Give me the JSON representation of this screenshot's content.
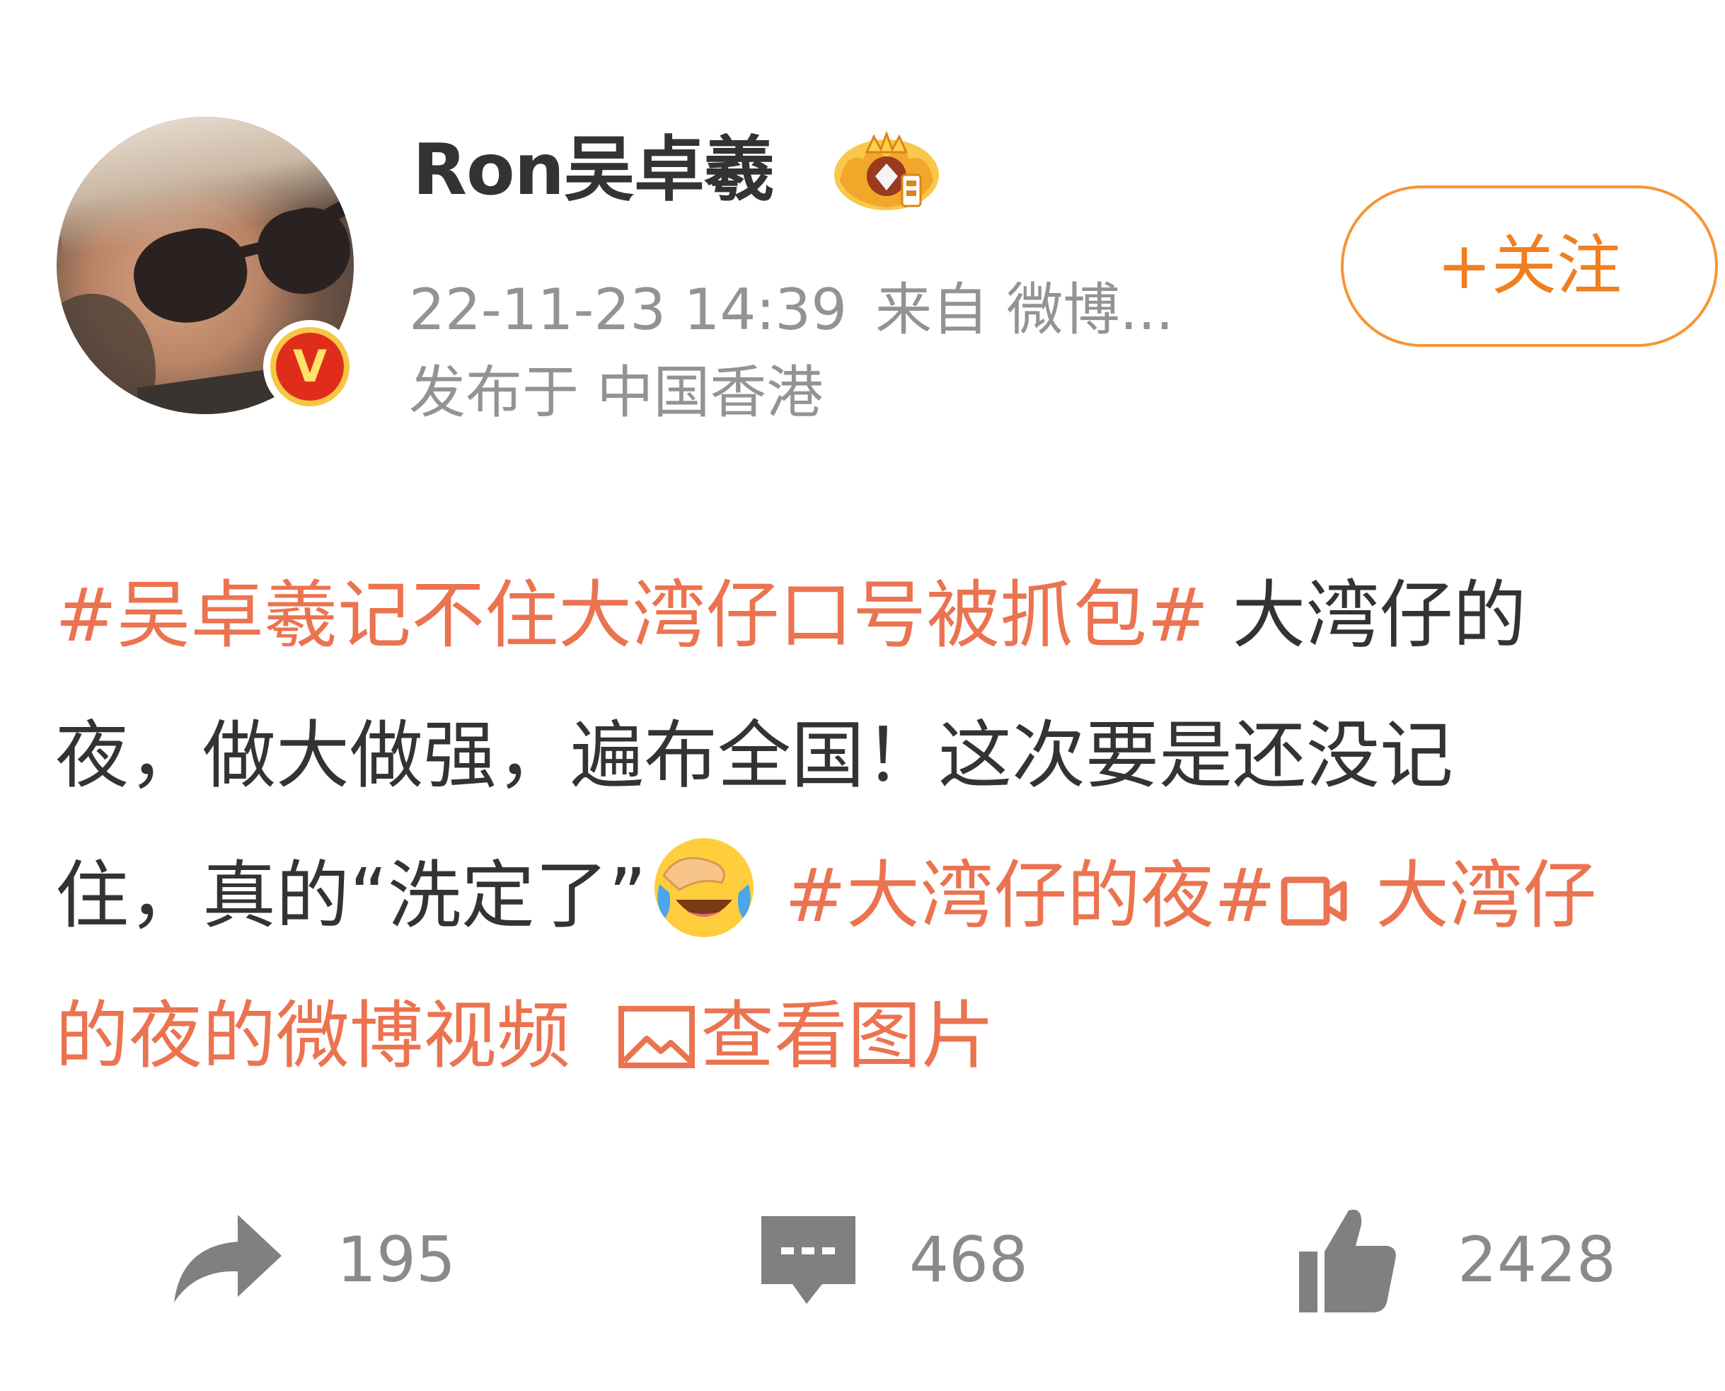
{
  "user": {
    "name": "Ron吴卓羲",
    "avatar_icon": "avatar-photo",
    "verified_badge": "V",
    "vip_icon": "crown-icon"
  },
  "meta": {
    "timestamp": "22-11-23 14:39",
    "source": "来自 微博...",
    "location": "发布于 中国香港"
  },
  "follow_button": {
    "label": "+关注"
  },
  "post": {
    "line1": {
      "tag": "#吴卓羲记不住大湾仔口号被抓包#",
      "text": " 大湾仔的"
    },
    "line2": {
      "text": "夜，做大做强，遍布全国！这次要是还没记"
    },
    "line3": {
      "text": "住，真的“洗定了”",
      "tag": " #大湾仔的夜#",
      "video_link": " 大湾仔"
    },
    "line4": {
      "video_link": "的夜的微博视频",
      "picture_link": "查看图片"
    },
    "emoji_icon": "laugh-cry-emoji",
    "video_icon": "video-icon",
    "picture_icon": "image-icon"
  },
  "actions": {
    "share": {
      "count": "195",
      "icon": "share-icon"
    },
    "comment": {
      "count": "468",
      "icon": "comment-icon"
    },
    "like": {
      "count": "2428",
      "icon": "thumbs-up-icon"
    }
  },
  "colors": {
    "accent": "#eb7350",
    "follow": "#f07f20",
    "meta": "#939393",
    "text": "#333333"
  }
}
